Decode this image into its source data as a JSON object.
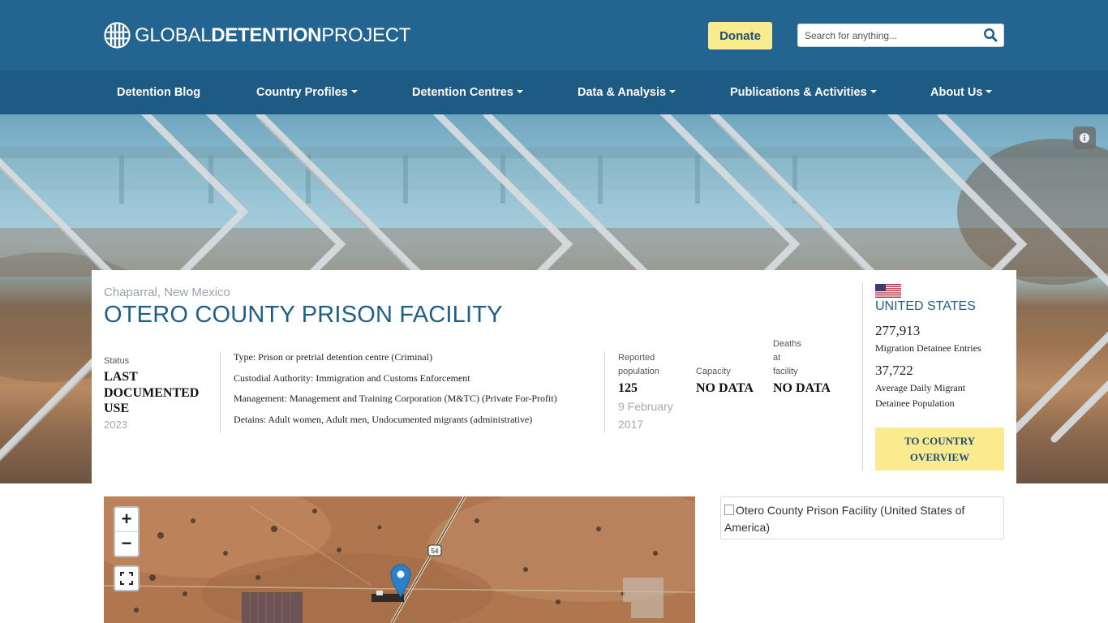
{
  "header": {
    "logo_text_a": "GLOBAL",
    "logo_text_b": "DETENTION",
    "logo_text_c": "PROJECT",
    "donate_label": "Donate",
    "search_placeholder": "Search for anything..."
  },
  "nav": {
    "items": [
      {
        "label": "Detention Blog",
        "dropdown": false
      },
      {
        "label": "Country Profiles",
        "dropdown": true
      },
      {
        "label": "Detention Centres",
        "dropdown": true
      },
      {
        "label": "Data & Analysis",
        "dropdown": true
      },
      {
        "label": "Publications & Activities",
        "dropdown": true
      },
      {
        "label": "About Us",
        "dropdown": true
      }
    ]
  },
  "facility": {
    "location": "Chaparral, New Mexico",
    "name": "OTERO COUNTY PRISON FACILITY",
    "status_label": "Status",
    "status_line1": "LAST",
    "status_line2": "DOCUMENTED",
    "status_line3": "USE",
    "status_year": "2023",
    "type": "Type: Prison or pretrial detention centre (Criminal)",
    "authority": "Custodial Authority: Immigration and Customs Enforcement",
    "management": "Management: Management and Training Corporation (M&TC) (Private For-Profit)",
    "detains": "Detains: Adult women, Adult men, Undocumented migrants (administrative)",
    "population_label_1": "Reported",
    "population_label_2": "population",
    "population_value": "125",
    "population_date_1": "9 February",
    "population_date_2": "2017",
    "capacity_label": "Capacity",
    "capacity_value": "NO DATA",
    "deaths_label_1": "Deaths",
    "deaths_label_2": "at",
    "deaths_label_3": "facility",
    "deaths_value": "NO DATA"
  },
  "country": {
    "name": "UNITED STATES",
    "entries_value": "277,913",
    "entries_label": "Migration Detainee Entries",
    "population_value": "37,722",
    "population_label_1": "Average Daily Migrant",
    "population_label_2": "Detainee Population",
    "overview_line1": "TO COUNTRY",
    "overview_line2": "OVERVIEW"
  },
  "map": {
    "zoom_in": "+",
    "zoom_out": "−",
    "road_shield": "54"
  },
  "image": {
    "alt": "Otero County Prison Facility (United States of America)"
  },
  "colors": {
    "header_bg": "#236590",
    "nav_bg": "#1d5a84",
    "accent_yellow": "#fbeb8f",
    "title_blue": "#1f5e88"
  }
}
